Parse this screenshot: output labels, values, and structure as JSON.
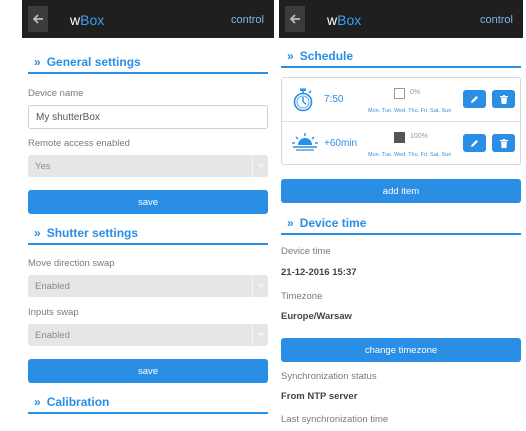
{
  "app": {
    "brand_prefix": "w",
    "brand_suffix": "Box",
    "control_label": "control",
    "colors": {
      "accent": "#2a8ee4",
      "topbar": "#1f1f1f",
      "select_bg": "#e6e6e6"
    }
  },
  "left": {
    "general": {
      "title": "General settings",
      "device_name_label": "Device name",
      "device_name_value": "My shutterBox",
      "remote_access_label": "Remote access enabled",
      "remote_access_value": "Yes",
      "save_label": "save"
    },
    "shutter": {
      "title": "Shutter settings",
      "direction_swap_label": "Move direction swap",
      "direction_swap_value": "Enabled",
      "inputs_swap_label": "Inputs swap",
      "inputs_swap_value": "Enabled",
      "save_label": "save"
    },
    "calibration": {
      "title": "Calibration"
    }
  },
  "right": {
    "schedule": {
      "title": "Schedule",
      "items": [
        {
          "icon": "stopwatch-icon",
          "time": "7:50",
          "position": "0%",
          "checked": false,
          "days": "Mon. Tue. Wed. Thu. Fri. Sat. Sun"
        },
        {
          "icon": "sunrise-icon",
          "time": "+60min",
          "position": "100%",
          "checked": true,
          "days": "Mon. Tue. Wed. Thu. Fri. Sat. Sun"
        }
      ],
      "add_label": "add item"
    },
    "device_time": {
      "title": "Device time",
      "time_label": "Device time",
      "time_value": "21-12-2016 15:37",
      "timezone_label": "Timezone",
      "timezone_value": "Europe/Warsaw",
      "change_tz_label": "change timezone",
      "sync_label": "Synchronization status",
      "sync_value": "From NTP server",
      "last_sync_label": "Last synchronization time"
    }
  }
}
